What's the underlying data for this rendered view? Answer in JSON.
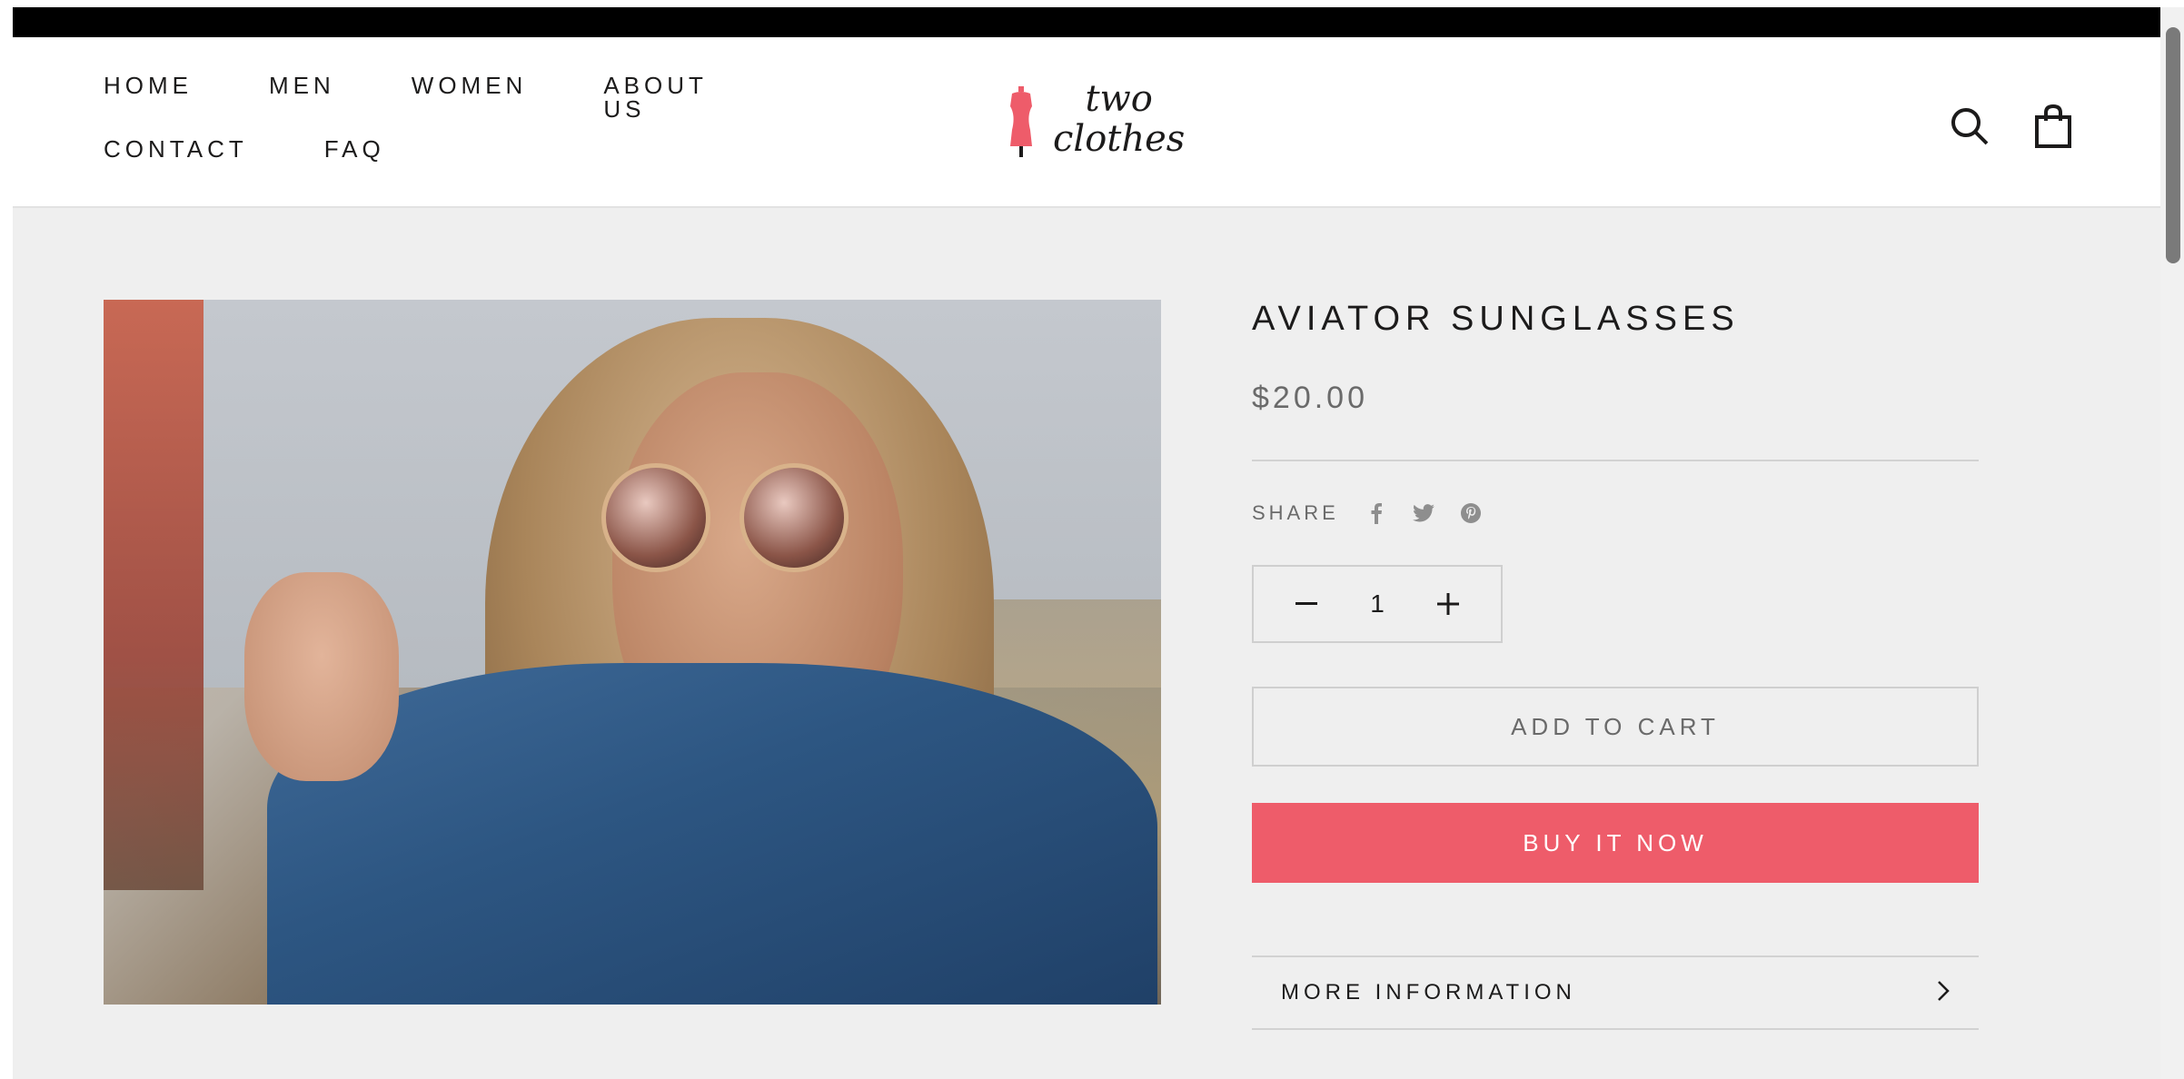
{
  "header": {
    "nav_row1": [
      "HOME",
      "MEN",
      "WOMEN",
      "ABOUT US"
    ],
    "nav_row2": [
      "CONTACT",
      "FAQ"
    ],
    "logo": {
      "line1": "two",
      "line2": "clothes",
      "mark_color": "#ee5c6a"
    }
  },
  "product": {
    "title": "AVIATOR SUNGLASSES",
    "price": "$20.00",
    "share_label": "SHARE",
    "share_icons": [
      "facebook-icon",
      "twitter-icon",
      "pinterest-icon"
    ],
    "quantity": "1",
    "add_to_cart_label": "ADD TO CART",
    "buy_now_label": "BUY IT NOW",
    "more_info_label": "MORE INFORMATION"
  },
  "colors": {
    "accent": "#ee5c6a",
    "background": "#efefef",
    "top_bar": "#000000"
  }
}
